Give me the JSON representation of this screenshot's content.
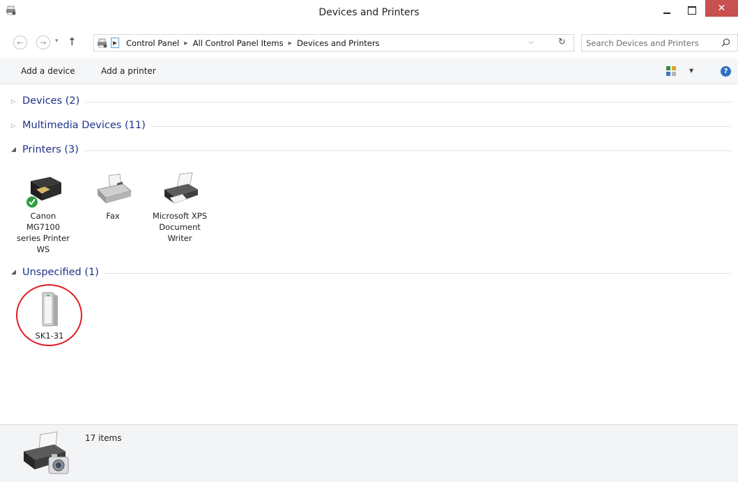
{
  "window": {
    "title": "Devices and Printers"
  },
  "address": {
    "crumbs": [
      "Control Panel",
      "All Control Panel Items",
      "Devices and Printers"
    ],
    "search_placeholder": "Search Devices and Printers"
  },
  "commands": {
    "add_device": "Add a device",
    "add_printer": "Add a printer"
  },
  "groups": {
    "devices": {
      "label": "Devices (2)",
      "expanded": false
    },
    "multimedia": {
      "label": "Multimedia Devices (11)",
      "expanded": false
    },
    "printers": {
      "label": "Printers (3)",
      "expanded": true
    },
    "unspecified": {
      "label": "Unspecified (1)",
      "expanded": true
    }
  },
  "printers": [
    {
      "label": "Canon MG7100 series Printer WS",
      "icon": "inkjet-printer-icon",
      "status": "default"
    },
    {
      "label": "Fax",
      "icon": "fax-icon"
    },
    {
      "label": "Microsoft XPS Document Writer",
      "icon": "printer-icon"
    }
  ],
  "unspecified": [
    {
      "label": "SK1-31",
      "icon": "tower-pc-icon"
    }
  ],
  "details": {
    "count": "17 items"
  },
  "colors": {
    "group_header": "#1e3287",
    "close_button": "#c75050",
    "highlight_circle": "#e01b24",
    "details_bg": "#f3f4f6"
  }
}
